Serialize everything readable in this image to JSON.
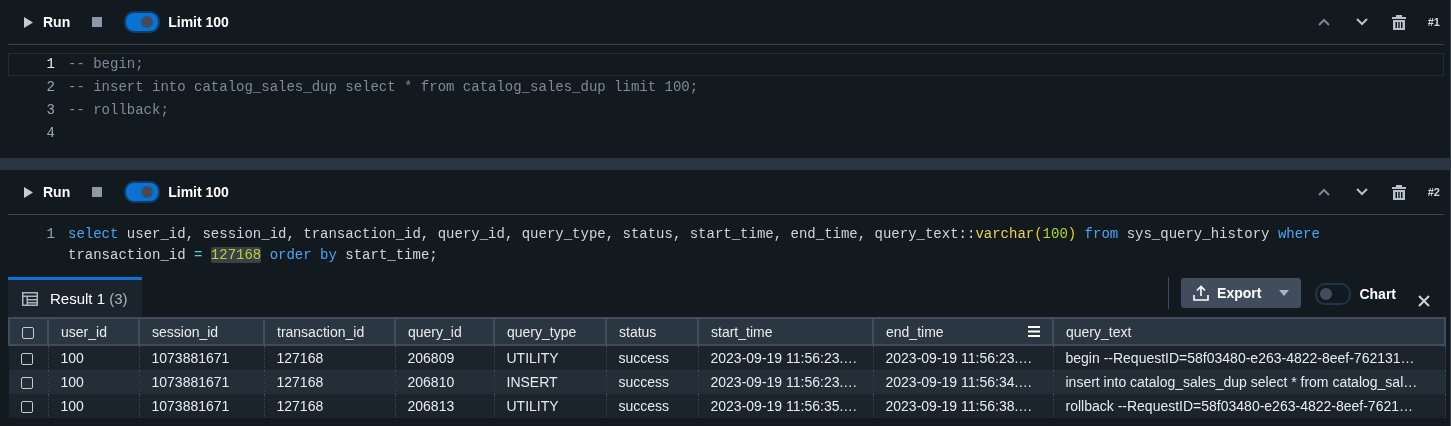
{
  "cells": [
    {
      "run_label": "Run",
      "limit": {
        "label": "Limit 100",
        "on": true
      },
      "number": "#1",
      "lines": [
        {
          "number": "1",
          "current": true,
          "rows": [
            {
              "tokens": [
                {
                  "kind": "comment",
                  "text": "-- begin;"
                }
              ]
            }
          ]
        },
        {
          "number": "2",
          "current": false,
          "rows": [
            {
              "tokens": [
                {
                  "kind": "comment",
                  "text": "-- insert into catalog_sales_dup select * from catalog_sales_dup limit 100;"
                }
              ]
            }
          ]
        },
        {
          "number": "3",
          "current": false,
          "rows": [
            {
              "tokens": [
                {
                  "kind": "comment",
                  "text": "-- rollback;"
                }
              ]
            }
          ]
        },
        {
          "number": "4",
          "current": false
        }
      ]
    },
    {
      "run_label": "Run",
      "limit": {
        "label": "Limit 100",
        "on": true
      },
      "number": "#2",
      "lines": [
        {
          "number": "1",
          "current": false,
          "rows": [
            {
              "tokens": [
                {
                  "kind": "keyword",
                  "text": "select"
                },
                {
                  "kind": "plain",
                  "text": " user_id, session_id, transaction_id, query_id, query_type, status, start_time, end_time, query_text::"
                },
                {
                  "kind": "function",
                  "text": "varchar"
                },
                {
                  "kind": "paren",
                  "text": "("
                },
                {
                  "kind": "number",
                  "text": "100"
                },
                {
                  "kind": "paren",
                  "text": ")"
                },
                {
                  "kind": "keyword",
                  "text": " from"
                },
                {
                  "kind": "plain",
                  "text": " sys_query_history "
                },
                {
                  "kind": "keyword",
                  "text": "where"
                }
              ]
            },
            {
              "tokens": [
                {
                  "kind": "plain",
                  "text": "transaction_id "
                },
                {
                  "kind": "operator",
                  "text": "= "
                },
                {
                  "kind": "match",
                  "text": "127168"
                },
                {
                  "kind": "keyword",
                  "text": " order by"
                },
                {
                  "kind": "plain",
                  "text": " start_time;"
                }
              ]
            }
          ]
        }
      ],
      "results": {
        "tabs": [
          {
            "label": "Result 1",
            "count": "(3)",
            "selected": true
          }
        ],
        "export_label": "Export",
        "chart": {
          "label": "Chart",
          "on": false
        },
        "all_checked": false,
        "columns": [
          {
            "label": "user_id",
            "menu": false
          },
          {
            "label": "session_id",
            "menu": false
          },
          {
            "label": "transaction_id",
            "menu": false
          },
          {
            "label": "query_id",
            "menu": false
          },
          {
            "label": "query_type",
            "menu": false
          },
          {
            "label": "status",
            "menu": false
          },
          {
            "label": "start_time",
            "menu": false
          },
          {
            "label": "end_time",
            "menu": true
          },
          {
            "label": "query_text",
            "menu": false
          }
        ],
        "rows": [
          {
            "checked": false,
            "cells": [
              "100",
              "1073881671",
              "127168",
              "206809",
              "UTILITY",
              "success",
              "2023-09-19 11:56:23.…",
              "2023-09-19 11:56:23.…",
              "begin --RequestID=58f03480-e263-4822-8eef-762131…"
            ]
          },
          {
            "checked": false,
            "cells": [
              "100",
              "1073881671",
              "127168",
              "206810",
              "INSERT",
              "success",
              "2023-09-19 11:56:23.…",
              "2023-09-19 11:56:34.…",
              "insert into catalog_sales_dup select * from catalog_sal…"
            ]
          },
          {
            "checked": false,
            "cells": [
              "100",
              "1073881671",
              "127168",
              "206813",
              "UTILITY",
              "success",
              "2023-09-19 11:56:35.…",
              "2023-09-19 11:56:38.…",
              "rollback --RequestID=58f03480-e263-4822-8eef-7621…"
            ]
          }
        ]
      }
    }
  ]
}
